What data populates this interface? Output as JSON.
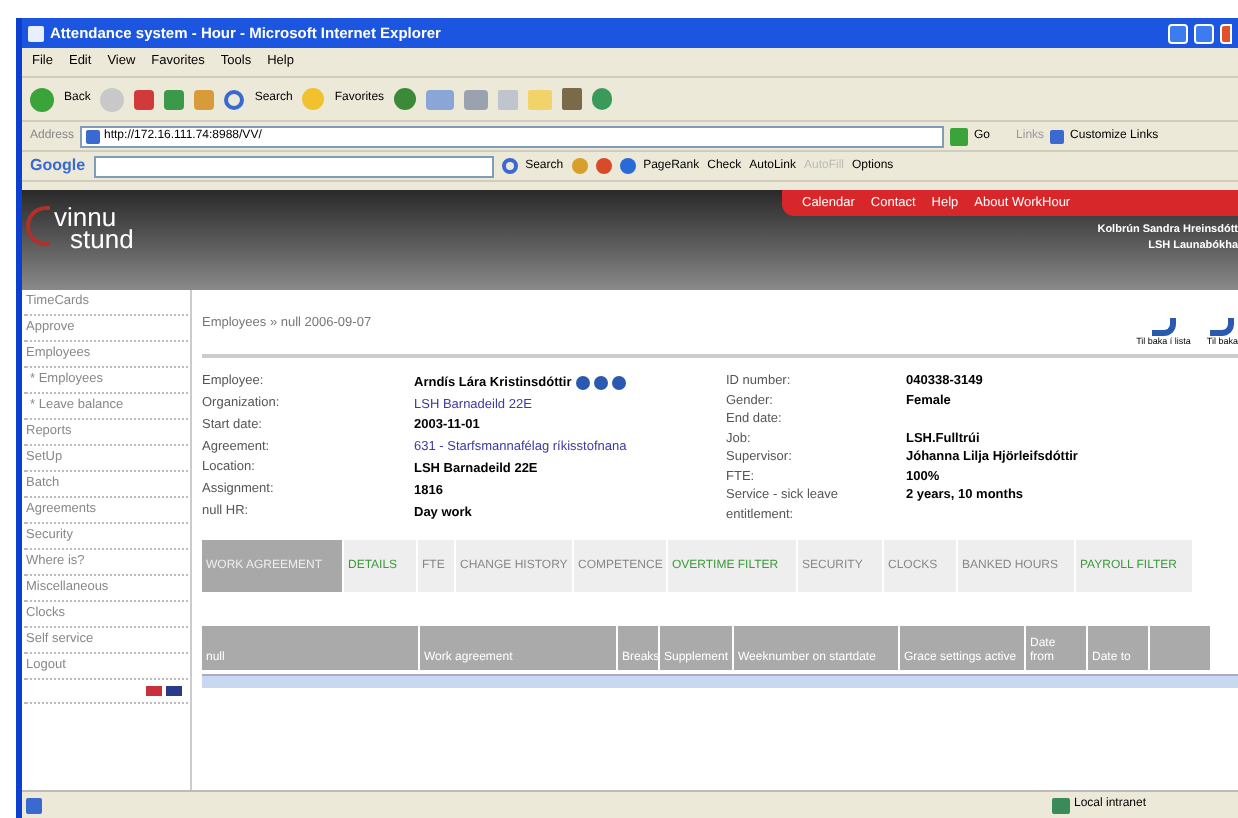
{
  "window": {
    "title": "Attendance system - Hour - Microsoft Internet Explorer"
  },
  "menu": [
    "File",
    "Edit",
    "View",
    "Favorites",
    "Tools",
    "Help"
  ],
  "toolbar": {
    "back": "Back",
    "search": "Search",
    "favorites": "Favorites"
  },
  "address": {
    "label": "Address",
    "value": "http://172.16.111.74:8988/VV/",
    "go": "Go",
    "links": "Links",
    "customize": "Customize Links"
  },
  "google_bar": {
    "logo": "Google",
    "search": "Search",
    "pagerank": "PageRank",
    "check": "Check",
    "autolink": "AutoLink",
    "autofill": "AutoFill",
    "autofill_disabled": true,
    "options": "Options"
  },
  "header": {
    "logo": [
      "vinnu",
      "stund"
    ],
    "nav": [
      "Calendar",
      "Contact",
      "Help",
      "About WorkHour"
    ],
    "user": [
      "Kolbrún Sandra Hreinsdótt",
      "LSH Launabókha"
    ]
  },
  "sidebar": {
    "items": [
      {
        "label": "TimeCards"
      },
      {
        "label": "Approve"
      },
      {
        "label": "Employees",
        "children": [
          {
            "label": "* Employees"
          },
          {
            "label": "* Leave balance"
          }
        ]
      },
      {
        "label": "Reports"
      },
      {
        "label": "SetUp"
      },
      {
        "label": "Batch"
      },
      {
        "label": "Agreements"
      },
      {
        "label": "Security"
      },
      {
        "label": "Where is?"
      },
      {
        "label": "Miscellaneous"
      },
      {
        "label": "Clocks"
      },
      {
        "label": "Self service"
      },
      {
        "label": "Logout"
      }
    ]
  },
  "breadcrumb": "Employees » null 2006-09-07",
  "actions": [
    "Til baka í lista",
    "Til baka"
  ],
  "fields_left": [
    {
      "label": "Employee:",
      "value": "Arndís Lára Kristinsdóttir",
      "kind": "employee"
    },
    {
      "label": "Organization:",
      "value": "LSH Barnadeild 22E",
      "kind": "link"
    },
    {
      "label": "Start date:",
      "value": "2003-11-01",
      "kind": "text"
    },
    {
      "label": "Agreement:",
      "value": "631 - Starfsmannafélag ríkisstofnana",
      "kind": "link"
    },
    {
      "label": "Location:",
      "value": "LSH Barnadeild 22E",
      "kind": "text"
    },
    {
      "label": "Assignment:",
      "value": "1816",
      "kind": "text"
    },
    {
      "label": "null HR:",
      "value": "Day work",
      "kind": "text"
    }
  ],
  "fields_right": [
    {
      "label": "ID number:",
      "value": "040338-3149"
    },
    {
      "label": "Gender:",
      "value": "Female"
    },
    {
      "label": "End date:"
    },
    {
      "label": "Job:",
      "value": "LSH.Fulltrúi"
    },
    {
      "label": "Supervisor:",
      "value": "Jóhanna Lilja Hjörleifsdóttir"
    },
    {
      "label": "FTE:",
      "value": "100%"
    },
    {
      "label": "Service - sick leave entitlement:",
      "value": "2 years, 10 months"
    }
  ],
  "tabs": [
    {
      "label": "WORK AGREEMENT",
      "selected": true,
      "highlighted": false
    },
    {
      "label": "DETAILS",
      "selected": false,
      "highlighted": true
    },
    {
      "label": "FTE",
      "selected": false,
      "highlighted": false
    },
    {
      "label": "CHANGE HISTORY",
      "selected": false,
      "highlighted": false
    },
    {
      "label": "COMPETENCE",
      "selected": false,
      "highlighted": false
    },
    {
      "label": "OVERTIME FILTER",
      "selected": false,
      "highlighted": true
    },
    {
      "label": "SECURITY",
      "selected": false,
      "highlighted": false
    },
    {
      "label": "CLOCKS",
      "selected": false,
      "highlighted": false
    },
    {
      "label": "BANKED HOURS",
      "selected": false,
      "highlighted": false
    },
    {
      "label": "PAYROLL FILTER",
      "selected": false,
      "highlighted": true
    }
  ],
  "table": {
    "columns": [
      "null",
      "Work agreement",
      "Breaks",
      "Supplement",
      "Weeknumber on startdate",
      "Grace settings active",
      "Date from",
      "Date to"
    ]
  },
  "status_bar": {
    "zone": "Local intranet"
  }
}
